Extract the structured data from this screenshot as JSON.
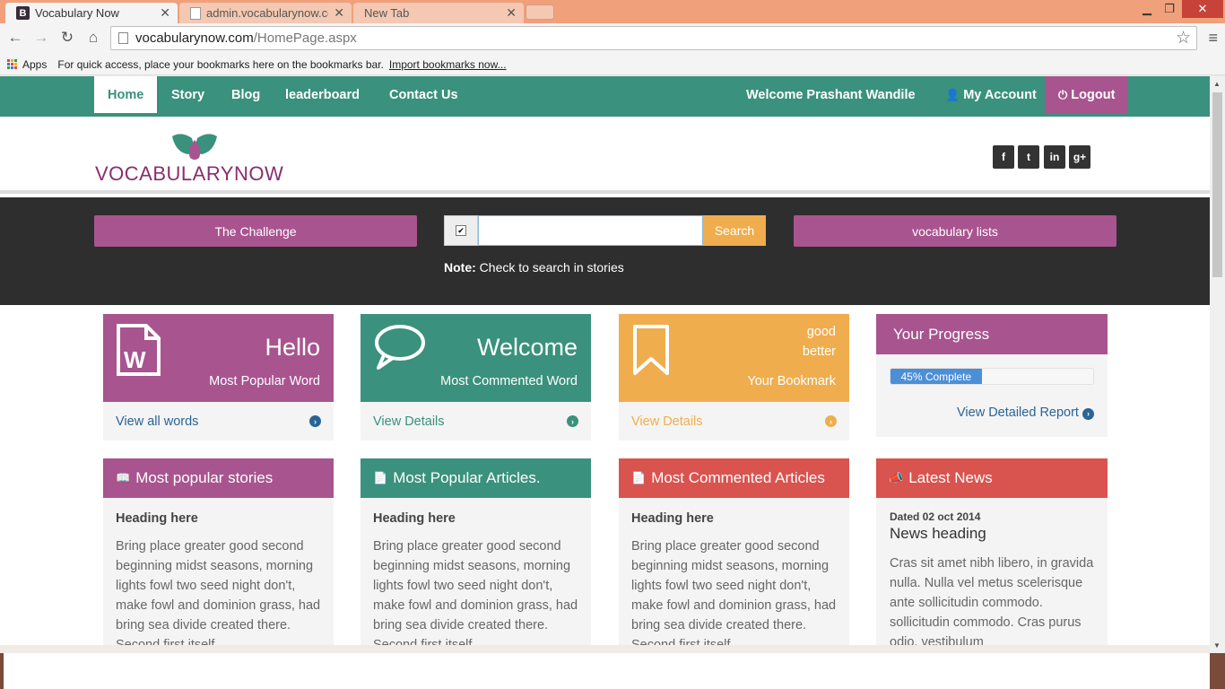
{
  "browser": {
    "tabs": [
      {
        "label": "Vocabulary Now",
        "favicon": "B",
        "active": true
      },
      {
        "label": "admin.vocabularynow.co",
        "active": false
      },
      {
        "label": "New Tab",
        "active": false
      }
    ],
    "url_host": "vocabularynow.com",
    "url_path": "/HomePage.aspx",
    "bookmarks_apps": "Apps",
    "bookmarks_hint": "For quick access, place your bookmarks here on the bookmarks bar.",
    "bookmarks_import": "Import bookmarks now..."
  },
  "nav": {
    "items": [
      "Home",
      "Story",
      "Blog",
      "leaderboard",
      "Contact Us"
    ],
    "welcome": "Welcome Prashant Wandile",
    "account": "My Account",
    "logout": "Logout"
  },
  "brand": {
    "logo_text": "VOCABULARYNOW"
  },
  "social": [
    "f",
    "t",
    "in",
    "g+"
  ],
  "band": {
    "challenge_label": "The Challenge",
    "search_value": "",
    "search_button": "Search",
    "lists_label": "vocabulary lists",
    "note_bold": "Note:",
    "note_text": " Check to search in stories"
  },
  "stats": [
    {
      "big": "Hello",
      "sub": "Most Popular Word",
      "link": "View all words",
      "color": "#a8548f",
      "link_color": "#2a6496"
    },
    {
      "big": "Welcome",
      "sub": "Most Commented Word",
      "link": "View Details",
      "color": "#3a917d",
      "link_color": "#3a917d"
    },
    {
      "line1": "good",
      "line2": "better",
      "sub": "Your Bookmark",
      "link": "View Details",
      "color": "#f0ad4e",
      "link_color": "#f0ad4e"
    }
  ],
  "progress": {
    "title": "Your Progress",
    "percent": 45,
    "label": "45% Complete",
    "link": "View Detailed Report"
  },
  "cards": [
    {
      "title": "Most popular stories",
      "color": "#a8548f",
      "heading": "Heading here",
      "body": "Bring place greater good second beginning midst seasons, morning lights fowl two seed night don't, make fowl and dominion grass, had bring sea divide created there. Second first itself"
    },
    {
      "title": "Most Popular Articles.",
      "color": "#3a917d",
      "heading": "Heading here",
      "body": "Bring place greater good second beginning midst seasons, morning lights fowl two seed night don't, make fowl and dominion grass, had bring sea divide created there. Second first itself"
    },
    {
      "title": "Most Commented Articles",
      "color": "#d9534f",
      "heading": "Heading here",
      "body": "Bring place greater good second beginning midst seasons, morning lights fowl two seed night don't, make fowl and dominion grass, had bring sea divide created there. Second first itself"
    }
  ],
  "news": {
    "title": "Latest News",
    "color": "#d9534f",
    "dated": "Dated 02 oct 2014",
    "heading": "News heading",
    "body": "Cras sit amet nibh libero, in gravida nulla. Nulla vel metus scelerisque ante sollicitudin commodo. sollicitudin commodo. Cras purus odio, vestibulum"
  }
}
